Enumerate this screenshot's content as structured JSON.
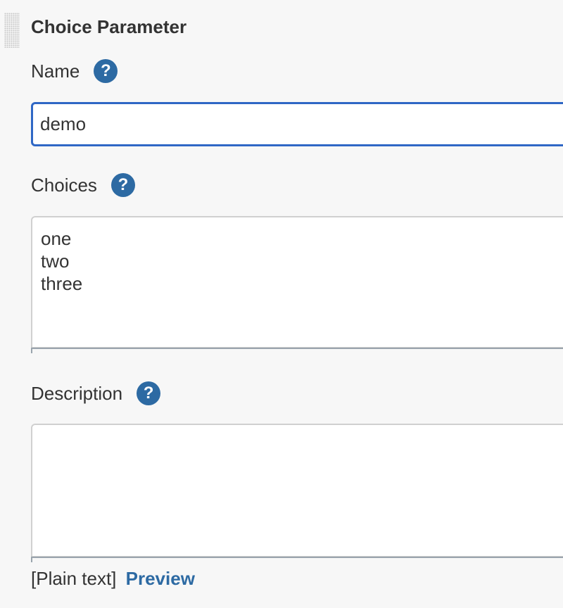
{
  "section": {
    "title": "Choice Parameter"
  },
  "fields": {
    "name": {
      "label": "Name",
      "value": "demo",
      "help": "?"
    },
    "choices": {
      "label": "Choices",
      "value": "one\ntwo\nthree",
      "help": "?"
    },
    "description": {
      "label": "Description",
      "value": "",
      "help": "?"
    }
  },
  "format": {
    "mode_label": "[Plain text]",
    "preview_label": "Preview"
  },
  "colors": {
    "accent": "#2d6aa3",
    "focus_border": "#2f67c5",
    "background": "#f7f7f7"
  }
}
